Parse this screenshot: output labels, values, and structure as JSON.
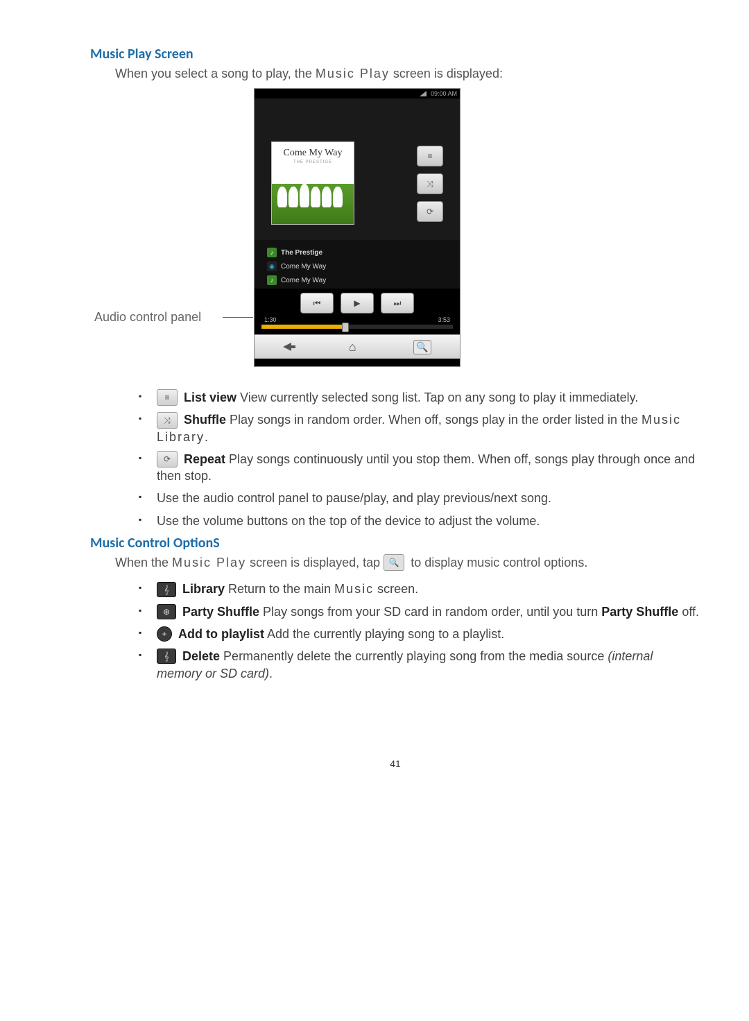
{
  "section1": {
    "heading": "Music Play Screen",
    "intro_a": "When you select a song to play, the ",
    "intro_term": "Music Play",
    "intro_b": " screen is displayed:"
  },
  "figure": {
    "caption": "Audio control panel",
    "status_time": "09:00 AM",
    "album_title": "Come My Way",
    "album_sub": "THE PRESTIGE",
    "meta": {
      "artist": "The Prestige",
      "album": "Come My Way",
      "track": "Come My Way"
    },
    "time_elapsed": "1:30",
    "time_total": "3:53"
  },
  "features": [
    {
      "icon": "≡",
      "name": "List view",
      "desc_a": "   View currently selected song list. Tap on any song to play it immediately."
    },
    {
      "icon": "⤨",
      "name": "Shuffle",
      "desc_a": "     Play songs in random order. When off, songs play in the order listed in the ",
      "term": "Music Library",
      "desc_b": "."
    },
    {
      "icon": "⟳",
      "name": "Repeat",
      "desc_a": "   Play songs continuously until you stop them. When off, songs play through once and then stop."
    },
    {
      "plain": "Use the audio control panel to pause/play, and play previous/next song."
    },
    {
      "plain": "Use the volume buttons on the top of the device to adjust the volume."
    }
  ],
  "section2": {
    "heading": "Music Control OptionS",
    "intro_a": "When the ",
    "intro_term": "Music Play",
    "intro_b": " screen is displayed, tap ",
    "intro_c": " to display music control options."
  },
  "options": [
    {
      "chip": "𝄞",
      "name": "Library",
      "desc_a": "   Return to the main ",
      "term": "Music",
      "desc_b": " screen."
    },
    {
      "chip": "⊕",
      "name": "Party Shuffle",
      "desc_a": "    Play songs from your SD card in random order, until you turn ",
      "bold2": "Party Shuffle",
      "desc_b": " off."
    },
    {
      "chip": "+",
      "chip_style": "circle",
      "name": "Add to playlist",
      "desc_a": "    Add the currently playing song to a playlist."
    },
    {
      "chip": "𝄞",
      "chip_extra": "trash",
      "name": "Delete",
      "desc_a": "    Permanently delete the currently playing song from the media source ",
      "italic": "(internal memory or SD card)",
      "desc_b": "."
    }
  ],
  "page_number": "41"
}
